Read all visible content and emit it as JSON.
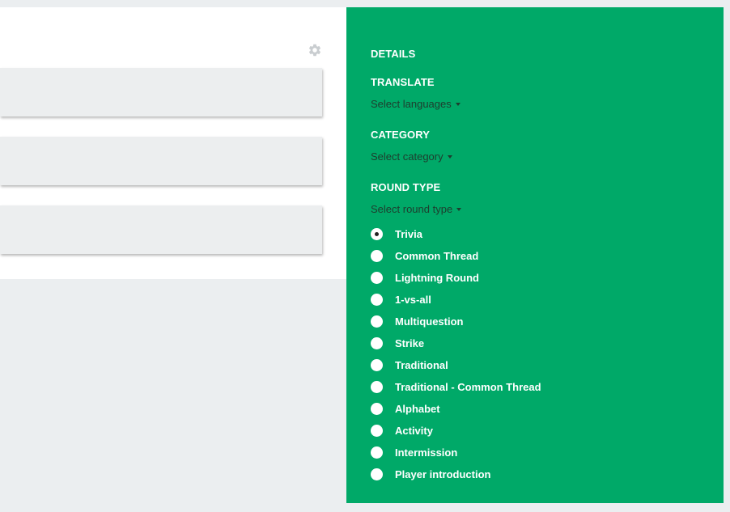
{
  "toolbar": {
    "settings_icon": "gear-icon"
  },
  "details": {
    "title": "DETAILS",
    "translate": {
      "label": "TRANSLATE",
      "placeholder": "Select languages"
    },
    "category": {
      "label": "CATEGORY",
      "placeholder": "Select category"
    },
    "round_type": {
      "label": "ROUND TYPE",
      "placeholder": "Select round type",
      "selected": "Trivia",
      "options": [
        "Trivia",
        "Common Thread",
        "Lightning Round",
        "1-vs-all",
        "Multiquestion",
        "Strike",
        "Traditional",
        "Traditional - Common Thread",
        "Alphabet",
        "Activity",
        "Intermission",
        "Player introduction"
      ]
    }
  },
  "colors": {
    "panel_bg": "#00a968",
    "page_bg": "#ebeef0",
    "card_bg": "#eceeef"
  }
}
